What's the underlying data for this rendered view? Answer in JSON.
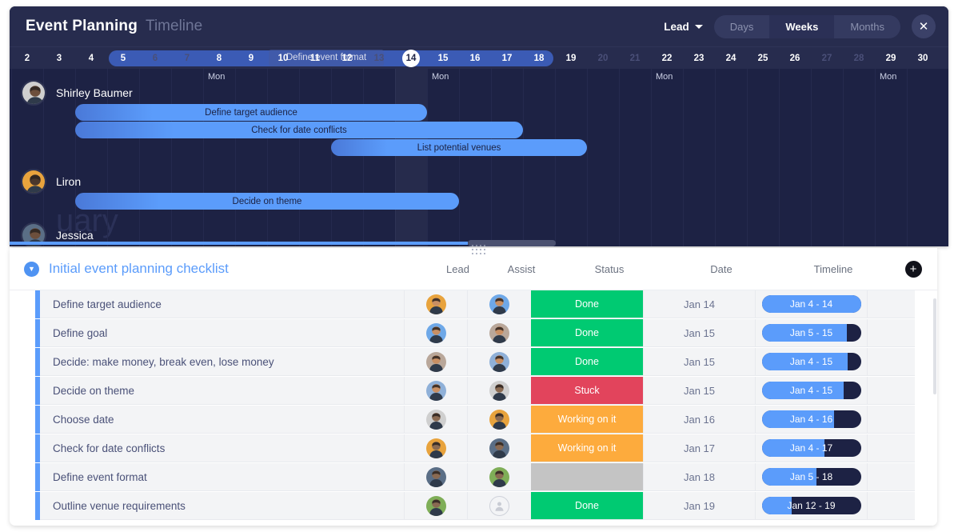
{
  "header": {
    "title": "Event Planning",
    "subtitle": "Timeline",
    "lead_filter": "Lead",
    "view_modes": [
      "Days",
      "Weeks",
      "Months"
    ],
    "active_view": "Weeks",
    "close_label": "✕"
  },
  "ruler": {
    "days": [
      2,
      3,
      4,
      5,
      6,
      7,
      8,
      9,
      10,
      11,
      12,
      13,
      14,
      15,
      16,
      17,
      18,
      19,
      20,
      21,
      22,
      23,
      24,
      25,
      26,
      27,
      28,
      29,
      30
    ],
    "weekend_days": [
      6,
      7,
      13,
      20,
      21,
      27,
      28
    ],
    "today": 14,
    "range_start": 5,
    "range_end": 18,
    "mon_labels": [
      8,
      15,
      22,
      29
    ],
    "mon_text": "Mon",
    "overlay_bar_label": "Define event format",
    "watermark": "uary"
  },
  "timeline_rows": [
    {
      "person": "Shirley Baumer",
      "avatar": "avatar-shirley",
      "bars": [
        {
          "label": "Define target audience",
          "start": 4,
          "end": 14
        },
        {
          "label": "Check for date conflicts",
          "start": 4,
          "end": 17
        },
        {
          "label": "List potential venues",
          "start": 12,
          "end": 19
        }
      ]
    },
    {
      "person": "Liron",
      "avatar": "avatar-liron",
      "bars": [
        {
          "label": "Decide on theme",
          "start": 4,
          "end": 15
        }
      ]
    },
    {
      "person": "Jessica",
      "avatar": "avatar-jessica",
      "bars": []
    }
  ],
  "table": {
    "group_title": "Initial event planning checklist",
    "columns": [
      "Lead",
      "Assist",
      "Status",
      "Date",
      "Timeline"
    ],
    "add_label": "+",
    "collapse_label": "▼",
    "colors": {
      "done": "#00ca72",
      "stuck": "#e2445c",
      "working": "#fdab3d",
      "empty": "#c4c4c4",
      "accent": "#5b9cfb"
    },
    "rows": [
      {
        "name": "Define target audience",
        "lead": "avatar-lead-1",
        "assist": "avatar-assist-1",
        "status": "Done",
        "status_color": "#00ca72",
        "date": "Jan 14",
        "timeline": "Jan 4 - 14",
        "progress": 100
      },
      {
        "name": "Define goal",
        "lead": "avatar-lead-2",
        "assist": "avatar-assist-2",
        "status": "Done",
        "status_color": "#00ca72",
        "date": "Jan 15",
        "timeline": "Jan 5 - 15",
        "progress": 86
      },
      {
        "name": "Decide: make money, break even, lose money",
        "lead": "avatar-lead-3",
        "assist": "avatar-assist-3",
        "status": "Done",
        "status_color": "#00ca72",
        "date": "Jan 15",
        "timeline": "Jan 4 - 15",
        "progress": 87
      },
      {
        "name": "Decide on theme",
        "lead": "avatar-lead-4",
        "assist": "avatar-assist-4",
        "status": "Stuck",
        "status_color": "#e2445c",
        "date": "Jan 15",
        "timeline": "Jan 4 - 15",
        "progress": 83
      },
      {
        "name": "Choose date",
        "lead": "avatar-lead-5",
        "assist": "avatar-assist-5",
        "status": "Working on it",
        "status_color": "#fdab3d",
        "date": "Jan 16",
        "timeline": "Jan 4 - 16",
        "progress": 73
      },
      {
        "name": "Check for date conflicts",
        "lead": "avatar-lead-6",
        "assist": "avatar-assist-6",
        "status": "Working on it",
        "status_color": "#fdab3d",
        "date": "Jan 17",
        "timeline": "Jan 4 - 17",
        "progress": 63
      },
      {
        "name": "Define event format",
        "lead": "avatar-lead-7",
        "assist": "avatar-assist-7",
        "status": "",
        "status_color": "#c4c4c4",
        "date": "Jan 18",
        "timeline": "Jan 5 - 18",
        "progress": 55
      },
      {
        "name": "Outline venue requirements",
        "lead": "avatar-lead-8",
        "assist": "avatar-empty",
        "status": "Done",
        "status_color": "#00ca72",
        "date": "Jan 19",
        "timeline": "Jan 12 - 19",
        "progress": 30
      }
    ]
  }
}
